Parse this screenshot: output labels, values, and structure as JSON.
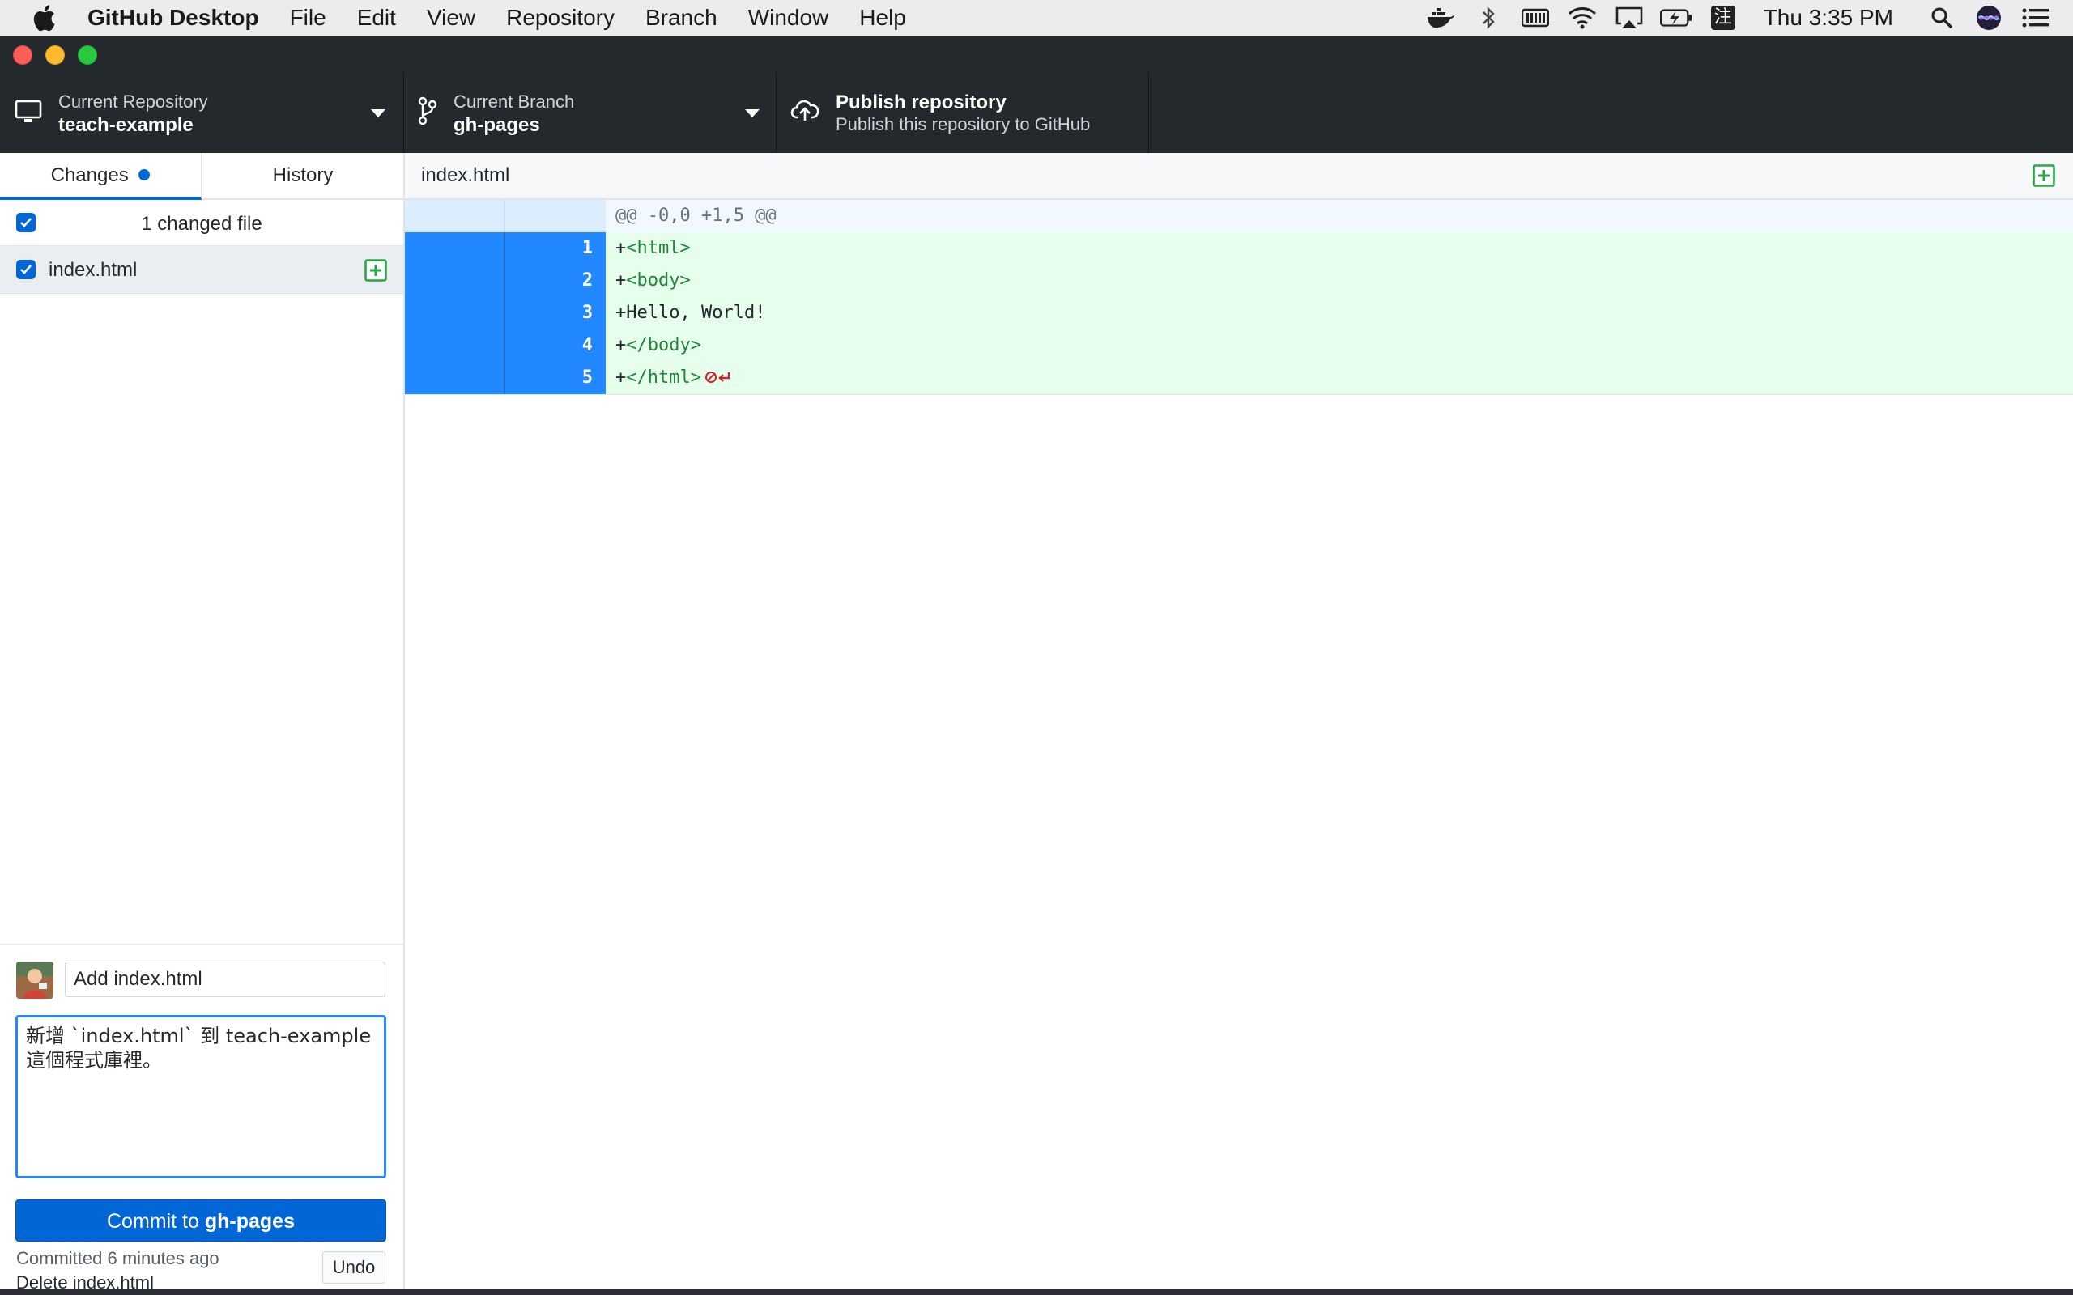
{
  "menubar": {
    "app_name": "GitHub Desktop",
    "items": [
      "File",
      "Edit",
      "View",
      "Repository",
      "Branch",
      "Window",
      "Help"
    ],
    "clock": "Thu 3:35 PM",
    "input_method": "注"
  },
  "toolbar": {
    "repository": {
      "label": "Current Repository",
      "value": "teach-example"
    },
    "branch": {
      "label": "Current Branch",
      "value": "gh-pages"
    },
    "publish": {
      "title": "Publish repository",
      "subtitle": "Publish this repository to GitHub"
    }
  },
  "sidebar": {
    "tabs": {
      "changes": "Changes",
      "history": "History"
    },
    "changed_files_label": "1 changed file",
    "files": [
      {
        "name": "index.html",
        "status": "added"
      }
    ]
  },
  "commit": {
    "summary": "Add index.html",
    "description": "新增 `index.html` 到 teach-example 這個程式庫裡。",
    "button_prefix": "Commit to ",
    "button_branch": "gh-pages",
    "last_commit_time": "Committed 6 minutes ago",
    "last_commit_message": "Delete index.html",
    "undo_label": "Undo"
  },
  "diff": {
    "filename": "index.html",
    "hunk_header": "@@ -0,0 +1,5 @@",
    "lines": [
      {
        "num": "1",
        "prefix": "+",
        "text": "<html>",
        "tag": true
      },
      {
        "num": "2",
        "prefix": "+",
        "text": "<body>",
        "tag": true
      },
      {
        "num": "3",
        "prefix": "+",
        "text": "Hello, World!",
        "tag": false
      },
      {
        "num": "4",
        "prefix": "+",
        "text": "</body>",
        "tag": true
      },
      {
        "num": "5",
        "prefix": "+",
        "text": "</html>",
        "tag": true
      }
    ]
  },
  "colors": {
    "accent": "#0366d6",
    "toolbar_bg": "#24292e",
    "added_bg": "#e6ffed",
    "added_gutter": "#2188ff",
    "tag_green": "#22863a",
    "no_newline_red": "#cb2431"
  }
}
